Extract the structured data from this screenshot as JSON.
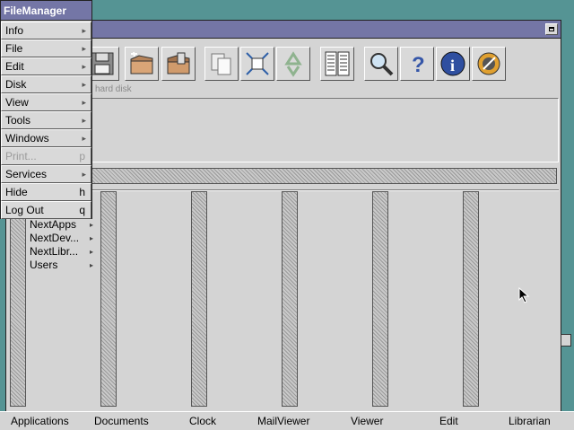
{
  "menu": {
    "title": "FileManager",
    "items": [
      {
        "label": "Info",
        "submenu": true,
        "key": "",
        "enabled": true
      },
      {
        "label": "File",
        "submenu": true,
        "key": "",
        "enabled": true
      },
      {
        "label": "Edit",
        "submenu": true,
        "key": "",
        "enabled": true
      },
      {
        "label": "Disk",
        "submenu": true,
        "key": "",
        "enabled": true
      },
      {
        "label": "View",
        "submenu": true,
        "key": "",
        "enabled": true
      },
      {
        "label": "Tools",
        "submenu": true,
        "key": "",
        "enabled": true
      },
      {
        "label": "Windows",
        "submenu": true,
        "key": "",
        "enabled": true
      },
      {
        "label": "Print...",
        "submenu": false,
        "key": "p",
        "enabled": false
      },
      {
        "label": "Services",
        "submenu": true,
        "key": "",
        "enabled": true
      },
      {
        "label": "Hide",
        "submenu": false,
        "key": "h",
        "enabled": true
      },
      {
        "label": "Log Out",
        "submenu": false,
        "key": "q",
        "enabled": true
      }
    ]
  },
  "toolbar": {
    "disk_label": "hard disk",
    "icons": [
      "floppy-disk-icon",
      "new-folder-icon",
      "open-folder-icon",
      "copy-icon",
      "compress-icon",
      "recycle-icon",
      "list-view-icon",
      "find-icon",
      "help-icon",
      "info-icon",
      "inspector-icon"
    ]
  },
  "browser": {
    "first_column_items": [
      {
        "label": "NextApps",
        "has_children": true
      },
      {
        "label": "NextDev...",
        "has_children": true
      },
      {
        "label": "NextLibr...",
        "has_children": true
      },
      {
        "label": "Users",
        "has_children": true
      }
    ]
  },
  "appbar": {
    "items": [
      "Applications",
      "Documents",
      "Clock",
      "MailViewer",
      "Viewer",
      "Edit",
      "Librarian"
    ]
  },
  "colors": {
    "desktop": "#559494",
    "titlebar": "#7476a6",
    "panel": "#d4d4d4"
  }
}
